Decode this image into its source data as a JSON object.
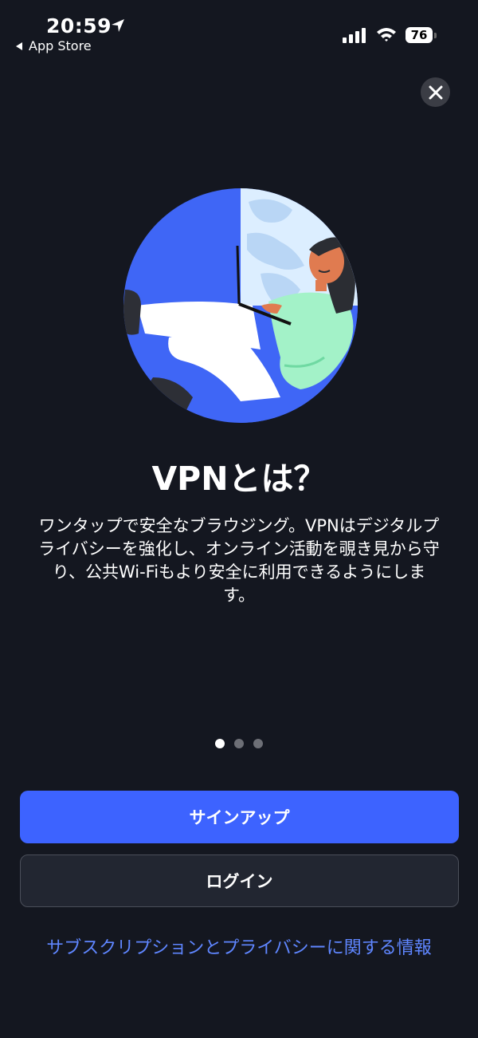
{
  "status_bar": {
    "time": "20:59",
    "back_app": "App Store",
    "battery": "76"
  },
  "onboarding": {
    "title": "VPNとは？",
    "description": "ワンタップで安全なブラウジング。VPNはデジタルプライバシーを強化し、オンライン活動を覗き見から守り、公共Wi-Fiもより安全に利用できるようにします。",
    "page_indicator": {
      "current": 1,
      "total": 3
    }
  },
  "actions": {
    "signup_label": "サインアップ",
    "login_label": "ログイン",
    "info_link": "サブスクリプションとプライバシーに関する情報"
  },
  "colors": {
    "background": "#141720",
    "primary": "#3d63ff",
    "link": "#5f86ff"
  }
}
